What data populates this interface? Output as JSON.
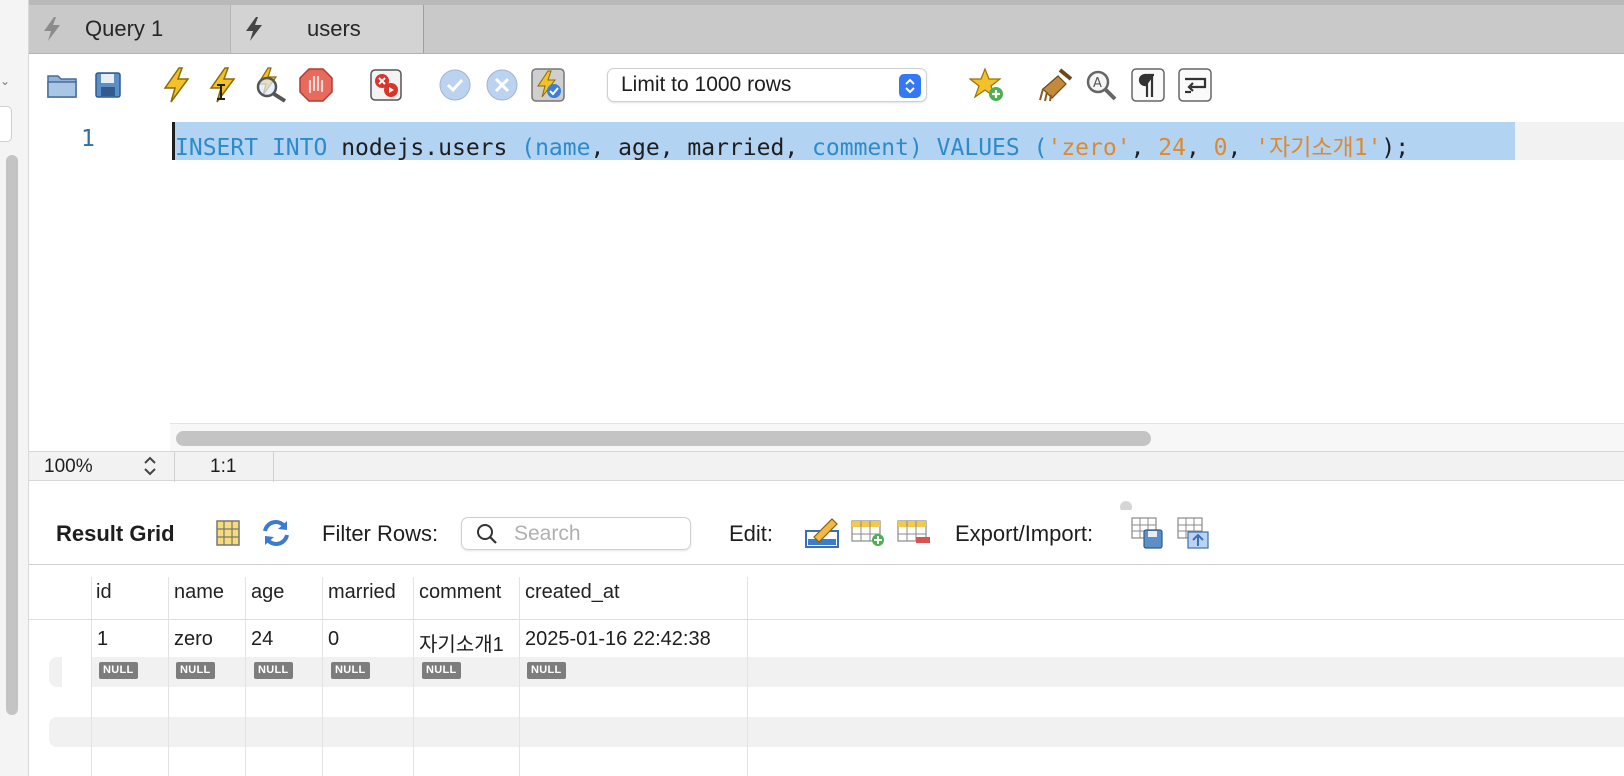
{
  "tabs": [
    {
      "label": "Query 1",
      "icon": "bolt-icon"
    },
    {
      "label": "users",
      "icon": "bolt-icon"
    }
  ],
  "toolbar": {
    "limit_select": "Limit to 1000 rows"
  },
  "editor": {
    "line_number": "1",
    "tokens": {
      "t01": "INSERT",
      "t02": " ",
      "t03": "INTO",
      "t04": " nodejs.users ",
      "t05": "(",
      "t06": "name",
      "t07": ", age, married, ",
      "t08": "comment",
      "t09": ") ",
      "t10": "VALUES",
      "t11": " (",
      "t12": "'zero'",
      "t13": ", ",
      "t14": "24",
      "t15": ", ",
      "t16": "0",
      "t17": ", ",
      "t18": "'자기소개1'",
      "t19": ");"
    }
  },
  "statusbar": {
    "zoom": "100%",
    "position": "1:1"
  },
  "result_toolbar": {
    "title": "Result Grid",
    "filter_label": "Filter Rows:",
    "search_placeholder": "Search",
    "edit_label": "Edit:",
    "export_label": "Export/Import:"
  },
  "grid": {
    "columns": [
      "id",
      "name",
      "age",
      "married",
      "comment",
      "created_at"
    ],
    "rows": [
      [
        "1",
        "zero",
        "24",
        "0",
        "자기소개1",
        "2025-01-16 22:42:38"
      ]
    ],
    "new_row_placeholder": "NULL"
  },
  "colors": {
    "keyword": "#2d8bc9",
    "literal": "#dd8a2f",
    "selection": "#b3d3f2",
    "tab_bar": "#c9c9c9"
  }
}
